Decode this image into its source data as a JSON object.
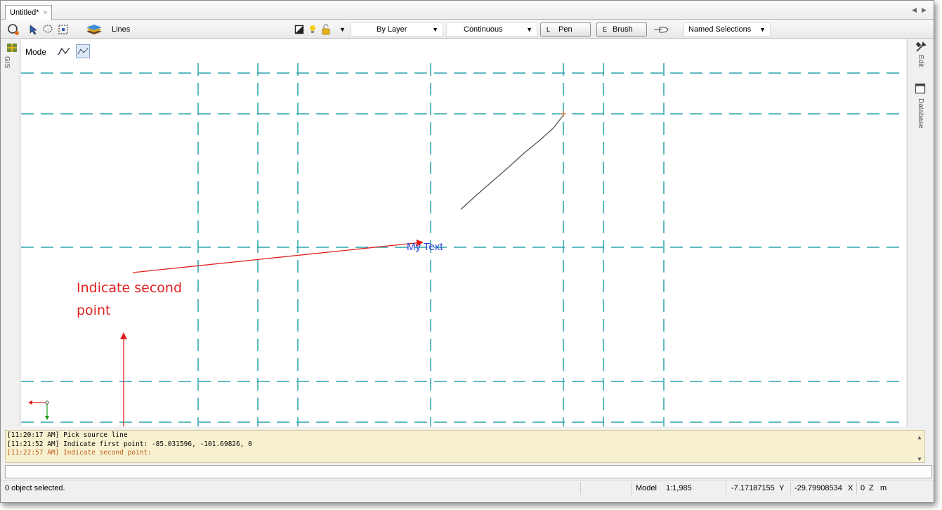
{
  "document_tab": {
    "title": "Untitled*",
    "close": "×"
  },
  "tab_nav": {
    "prev": "◀",
    "next": "▶"
  },
  "toolbar": {
    "layer": "Lines",
    "color": "By Layer",
    "linetype": "Continuous",
    "pen_key": "L",
    "pen_label": "Pen",
    "brush_key": "E",
    "brush_label": "Brush",
    "named_selections": "Named Selections"
  },
  "left_strip": {
    "gis_label": "GIS"
  },
  "right_strip": {
    "edit_label": "Edit",
    "database_label": "Database"
  },
  "modebar": {
    "label": "Mode"
  },
  "canvas": {
    "text_entity": "My Text"
  },
  "annotation": {
    "line1": "Indicate second",
    "line2": "point"
  },
  "log": {
    "lines": [
      "[11:20:17 AM] Pick source line",
      "[11:21:52 AM] Indicate first point: -85.031596, -101.69826, 0",
      "[11:22:57 AM] Indicate second point:"
    ]
  },
  "command_input": {
    "value": ""
  },
  "statusbar": {
    "selection": "0 object selected.",
    "space": "Model",
    "scale": "1:1,985",
    "y_value": "-7.17187155",
    "y_label": "Y",
    "x_value": "-29.79908534",
    "x_label": "X",
    "z_value": "0",
    "z_label": "Z",
    "unit": "m"
  },
  "colors": {
    "grid": "#2aa3ad",
    "annotation": "#e02020",
    "text_entity": "#2a3fd4",
    "log_background": "#f8f1d0",
    "log_warn": "#c0601c"
  }
}
